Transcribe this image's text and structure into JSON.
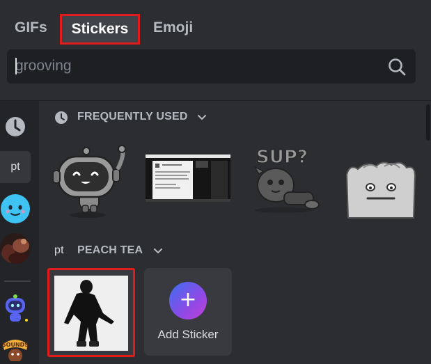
{
  "tabs": [
    {
      "label": "GIFs"
    },
    {
      "label": "Stickers",
      "selected": true
    },
    {
      "label": "Emoji"
    }
  ],
  "search": {
    "value": "grooving",
    "icon": "search-icon"
  },
  "rail": {
    "pack_abbrev": "pt",
    "items": [
      "clock-icon",
      "pack-pt",
      "smiley-face-icon",
      "photo-avatar",
      "robot-sticker-icon",
      "sounds-sticker-icon"
    ]
  },
  "sections": {
    "frequently_used": {
      "title": "FREQUENTLY USED",
      "icon": "clock-icon"
    },
    "peach_tea": {
      "title": "PEACH TEA",
      "abbrev": "pt"
    }
  },
  "add_sticker": {
    "label": "Add Sticker",
    "symbol": "+"
  },
  "colors": {
    "background": "#2b2d31",
    "rail": "#232428",
    "highlight_border": "#e01b1b",
    "selected_tab": "#404249"
  }
}
